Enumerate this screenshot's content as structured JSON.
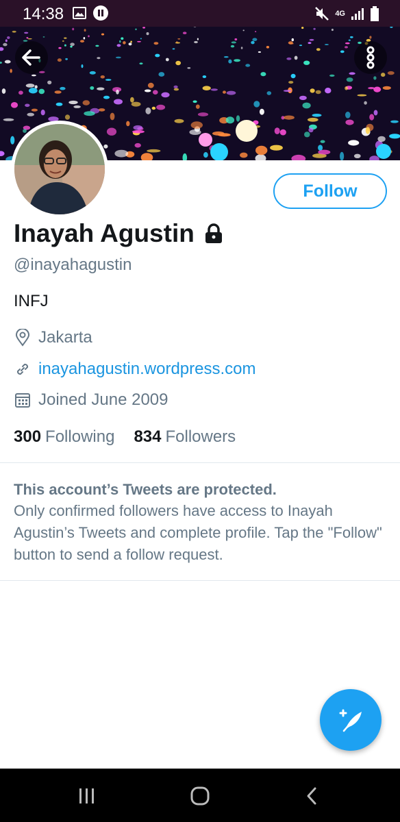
{
  "status_bar": {
    "time": "14:38",
    "network": "4G"
  },
  "header": {
    "back_icon": "arrow-left-icon",
    "more_icon": "more-vertical-icon"
  },
  "profile": {
    "follow_label": "Follow",
    "display_name": "Inayah Agustin",
    "handle": "@inayahagustin",
    "bio": "INFJ",
    "location": "Jakarta",
    "website": "inayahagustin.wordpress.com",
    "joined": "Joined June 2009",
    "following_count": "300",
    "following_label": "Following",
    "followers_count": "834",
    "followers_label": "Followers"
  },
  "protected_notice": {
    "title": "This account’s Tweets are protected.",
    "body": "Only confirmed followers have access to Inayah Agustin’s Tweets and complete profile. Tap the \"Follow\" button to send a follow request."
  },
  "colors": {
    "accent": "#1da1f2",
    "link": "#1b95e0",
    "secondary_text": "#657786",
    "status_bar_bg": "#2a1128"
  }
}
